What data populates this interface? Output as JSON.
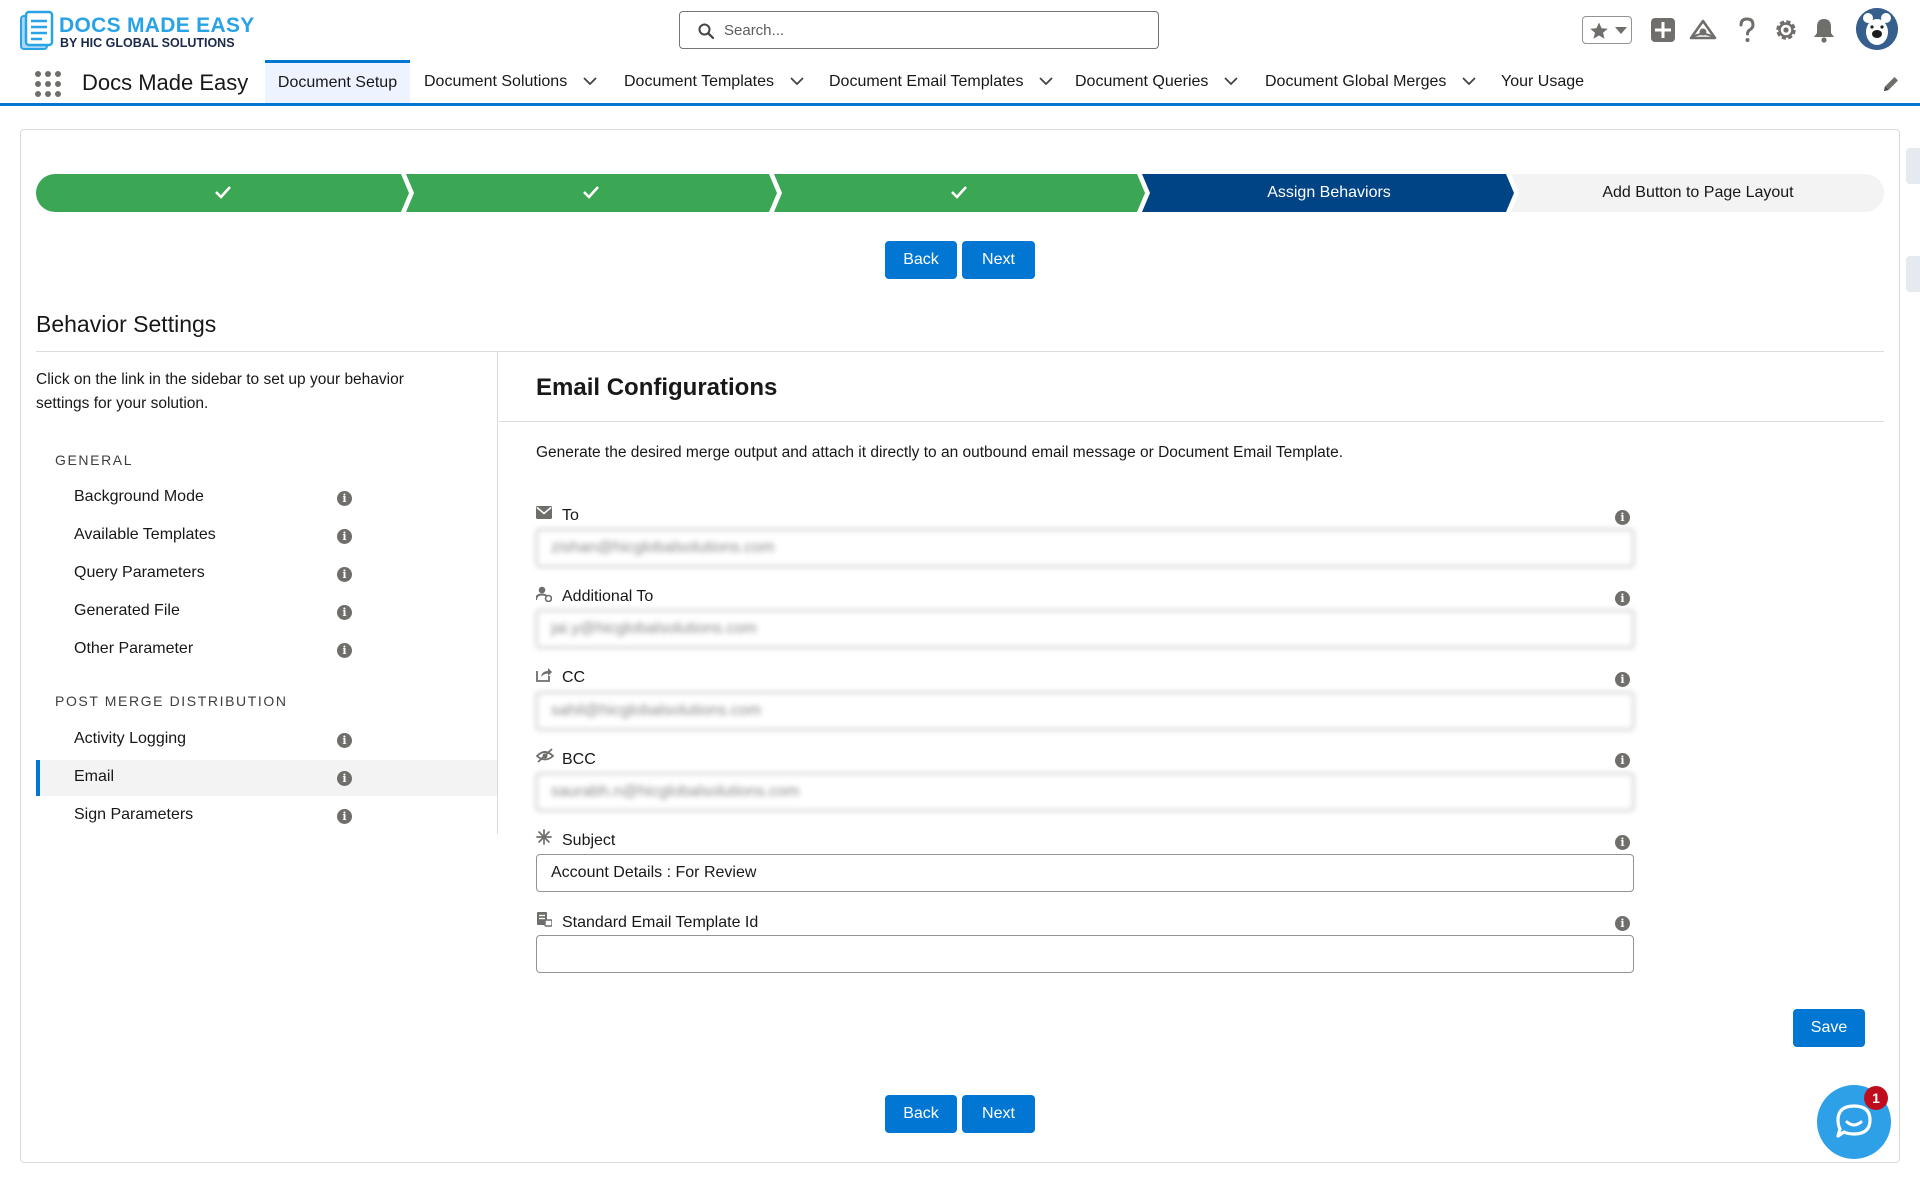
{
  "header": {
    "logo_title": "DOCS MADE EASY",
    "logo_subtitle": "BY HIC GLOBAL SOLUTIONS",
    "search_placeholder": "Search...",
    "icons": [
      "favorites-star-icon",
      "favorites-dropdown-icon",
      "add-icon",
      "trailhead-icon",
      "help-icon",
      "setup-gear-icon",
      "notifications-bell-icon",
      "user-avatar"
    ]
  },
  "nav": {
    "app_name": "Docs Made Easy",
    "tabs": [
      {
        "label": "Document Setup",
        "active": true,
        "dropdown": false
      },
      {
        "label": "Document Solutions",
        "dropdown": true
      },
      {
        "label": "Document Templates",
        "dropdown": true
      },
      {
        "label": "Document Email Templates",
        "dropdown": true
      },
      {
        "label": "Document Queries",
        "dropdown": true
      },
      {
        "label": "Document Global Merges",
        "dropdown": true
      },
      {
        "label": "Your Usage",
        "dropdown": false
      }
    ]
  },
  "path": {
    "steps": [
      {
        "label": "",
        "status": "complete"
      },
      {
        "label": "",
        "status": "complete"
      },
      {
        "label": "",
        "status": "complete"
      },
      {
        "label": "Assign Behaviors",
        "status": "current"
      },
      {
        "label": "Add Button to Page Layout",
        "status": "incomplete"
      }
    ]
  },
  "buttons": {
    "back": "Back",
    "next": "Next",
    "save": "Save"
  },
  "section_title": "Behavior Settings",
  "sidebar": {
    "intro": "Click on the link in the sidebar to set up your behavior settings for your solution.",
    "groups": [
      {
        "heading": "GENERAL",
        "items": [
          "Background Mode",
          "Available Templates",
          "Query Parameters",
          "Generated File",
          "Other Parameter"
        ]
      },
      {
        "heading": "POST MERGE DISTRIBUTION",
        "items": [
          "Activity Logging",
          "Email",
          "Sign Parameters"
        ]
      }
    ],
    "selected": "Email"
  },
  "main": {
    "title": "Email Configurations",
    "description": "Generate the desired merge output and attach it directly to an outbound email message or Document Email Template.",
    "fields": [
      {
        "label": "To",
        "icon": "email-icon",
        "value": "zishan@hicglobalsolutions.com",
        "obscured": true
      },
      {
        "label": "Additional To",
        "icon": "add-contact-icon",
        "value": "jai.y@hicglobalsolutions.com",
        "obscured": true
      },
      {
        "label": "CC",
        "icon": "share-icon",
        "value": "sahil@hicglobalsolutions.com",
        "obscured": true
      },
      {
        "label": "BCC",
        "icon": "hide-icon",
        "value": "saurabh.n@hicglobalsolutions.com",
        "obscured": true
      },
      {
        "label": "Subject",
        "icon": "sparkle-icon",
        "value": "Account Details : For Review",
        "obscured": false
      },
      {
        "label": "Standard Email Template Id",
        "icon": "template-icon",
        "value": "",
        "obscured": false
      }
    ]
  },
  "chat": {
    "badge": "1"
  },
  "colors": {
    "brand": "#0176d3",
    "complete": "#3ba755",
    "current": "#014486",
    "incomplete": "#f3f3f3"
  }
}
